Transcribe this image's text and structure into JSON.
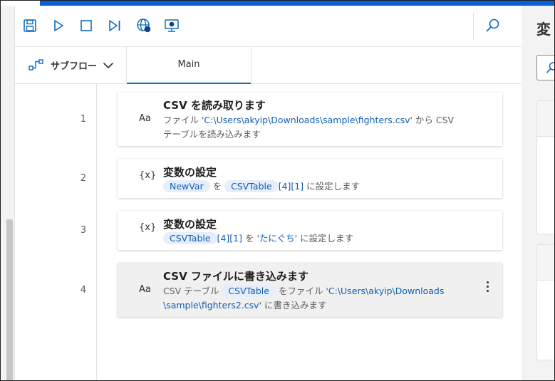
{
  "toolbar": {
    "icons": [
      "save-icon",
      "run-icon",
      "stop-icon",
      "run-next-action-icon",
      "web-recorder-icon",
      "desktop-recorder-icon",
      "search-icon"
    ]
  },
  "subflow": {
    "label": "サブフロー"
  },
  "tabs": {
    "main": "Main"
  },
  "actions": [
    {
      "line": "1",
      "icon": "Aa",
      "title": "CSV を読み取ります",
      "desc1_pre": "ファイル '",
      "desc1_path": "C:\\Users\\akyip\\Downloads\\sample\\fighters.csv",
      "desc1_post": "' から CSV",
      "desc2": "テーブルを読み込みます"
    },
    {
      "line": "2",
      "icon": "{x}",
      "title": "変数の設定",
      "var": "NewVar",
      "mid": "を",
      "value_pill": "CSVTable",
      "value_index": "[4][1]",
      "suffix": "に設定します"
    },
    {
      "line": "3",
      "icon": "{x}",
      "title": "変数の設定",
      "var_pill": "CSVTable",
      "var_index": "[4][1]",
      "mid": "を",
      "quote_open": "'",
      "value": "たにぐち",
      "quote_close": "'",
      "suffix": "に設定します"
    },
    {
      "line": "4",
      "icon": "Aa",
      "title": "CSV ファイルに書き込みます",
      "desc1_pre": "CSV テーブル",
      "desc1_pill": "CSVTable",
      "desc1_mid": "をファイル '",
      "desc1_path": "C:\\Users\\akyip\\Downloads",
      "desc2_path": "\\sample\\fighters2.csv",
      "desc2_post": "' に書き込みます"
    }
  ],
  "right_panel": {
    "title": "変"
  },
  "colors": {
    "accent": "#0f6cbd",
    "top_bar": "#0a5fd6",
    "token": "#0f5fb5",
    "pill_bg": "#e6eefb"
  }
}
